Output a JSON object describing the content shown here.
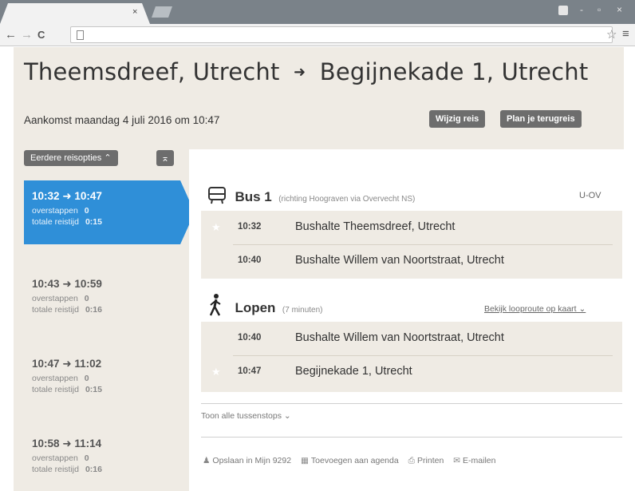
{
  "browser": {
    "tab_close": "×",
    "nav": {
      "back": "←",
      "forward": "→",
      "reload": "C"
    },
    "win_controls": [
      "-",
      "▫",
      "×"
    ]
  },
  "header": {
    "from": "Theemsdreef, Utrecht",
    "arrow": "➜",
    "to": "Begijnekade 1, Utrecht",
    "arrival": "Aankomst maandag 4 juli 2016 om 10:47",
    "change_trip": "Wijzig reis",
    "plan_return": "Plan je terugreis"
  },
  "sidebar": {
    "earlier": "Eerdere reisopties ⌃",
    "collapse": "⌅",
    "options": [
      {
        "time": "10:32 ➜ 10:47",
        "transfers_label": "overstappen",
        "transfers": "0",
        "duration_label": "totale reistijd",
        "duration": "0:15"
      },
      {
        "time": "10:43 ➜ 10:59",
        "transfers_label": "overstappen",
        "transfers": "0",
        "duration_label": "totale reistijd",
        "duration": "0:16"
      },
      {
        "time": "10:47 ➜ 11:02",
        "transfers_label": "overstappen",
        "transfers": "0",
        "duration_label": "totale reistijd",
        "duration": "0:15"
      },
      {
        "time": "10:58 ➜ 11:14",
        "transfers_label": "overstappen",
        "transfers": "0",
        "duration_label": "totale reistijd",
        "duration": "0:16"
      }
    ]
  },
  "legs": {
    "bus": {
      "title": "Bus 1",
      "subtitle": "(richting Hoograven via Overvecht NS)",
      "operator": "U-OV",
      "stops": [
        {
          "time": "10:32",
          "name": "Bushalte Theemsdreef, Utrecht"
        },
        {
          "time": "10:40",
          "name": "Bushalte Willem van Noortstraat, Utrecht"
        }
      ]
    },
    "walk": {
      "title": "Lopen",
      "subtitle": "(7 minuten)",
      "map_link": "Bekijk looproute op kaart ⌄",
      "stops": [
        {
          "time": "10:40",
          "name": "Bushalte Willem van Noortstraat, Utrecht"
        },
        {
          "time": "10:47",
          "name": "Begijnekade 1, Utrecht"
        }
      ]
    }
  },
  "footer": {
    "show_stops": "Toon alle tussenstops ⌄",
    "save": "Opslaan in Mijn 9292",
    "agenda": "Toevoegen aan agenda",
    "print": "Printen",
    "email": "E-mailen"
  }
}
